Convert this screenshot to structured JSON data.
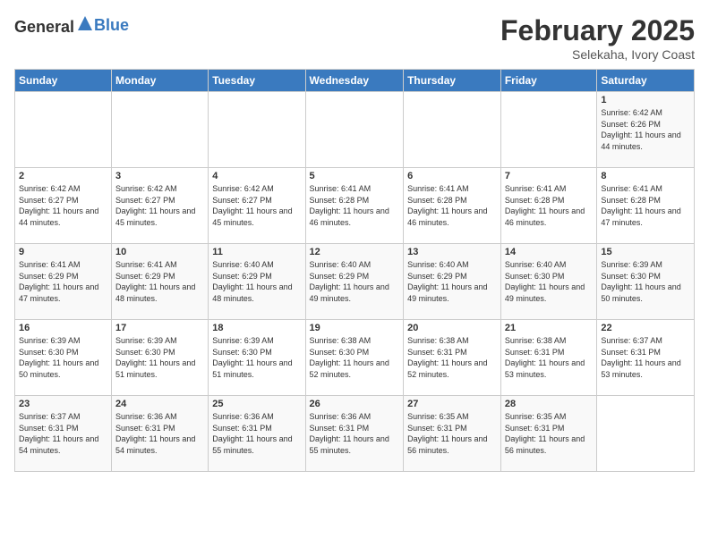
{
  "header": {
    "logo_general": "General",
    "logo_blue": "Blue",
    "month": "February 2025",
    "location": "Selekaha, Ivory Coast"
  },
  "days_of_week": [
    "Sunday",
    "Monday",
    "Tuesday",
    "Wednesday",
    "Thursday",
    "Friday",
    "Saturday"
  ],
  "weeks": [
    [
      {
        "day": "",
        "info": ""
      },
      {
        "day": "",
        "info": ""
      },
      {
        "day": "",
        "info": ""
      },
      {
        "day": "",
        "info": ""
      },
      {
        "day": "",
        "info": ""
      },
      {
        "day": "",
        "info": ""
      },
      {
        "day": "1",
        "info": "Sunrise: 6:42 AM\nSunset: 6:26 PM\nDaylight: 11 hours and 44 minutes."
      }
    ],
    [
      {
        "day": "2",
        "info": "Sunrise: 6:42 AM\nSunset: 6:27 PM\nDaylight: 11 hours and 44 minutes."
      },
      {
        "day": "3",
        "info": "Sunrise: 6:42 AM\nSunset: 6:27 PM\nDaylight: 11 hours and 45 minutes."
      },
      {
        "day": "4",
        "info": "Sunrise: 6:42 AM\nSunset: 6:27 PM\nDaylight: 11 hours and 45 minutes."
      },
      {
        "day": "5",
        "info": "Sunrise: 6:41 AM\nSunset: 6:28 PM\nDaylight: 11 hours and 46 minutes."
      },
      {
        "day": "6",
        "info": "Sunrise: 6:41 AM\nSunset: 6:28 PM\nDaylight: 11 hours and 46 minutes."
      },
      {
        "day": "7",
        "info": "Sunrise: 6:41 AM\nSunset: 6:28 PM\nDaylight: 11 hours and 46 minutes."
      },
      {
        "day": "8",
        "info": "Sunrise: 6:41 AM\nSunset: 6:28 PM\nDaylight: 11 hours and 47 minutes."
      }
    ],
    [
      {
        "day": "9",
        "info": "Sunrise: 6:41 AM\nSunset: 6:29 PM\nDaylight: 11 hours and 47 minutes."
      },
      {
        "day": "10",
        "info": "Sunrise: 6:41 AM\nSunset: 6:29 PM\nDaylight: 11 hours and 48 minutes."
      },
      {
        "day": "11",
        "info": "Sunrise: 6:40 AM\nSunset: 6:29 PM\nDaylight: 11 hours and 48 minutes."
      },
      {
        "day": "12",
        "info": "Sunrise: 6:40 AM\nSunset: 6:29 PM\nDaylight: 11 hours and 49 minutes."
      },
      {
        "day": "13",
        "info": "Sunrise: 6:40 AM\nSunset: 6:29 PM\nDaylight: 11 hours and 49 minutes."
      },
      {
        "day": "14",
        "info": "Sunrise: 6:40 AM\nSunset: 6:30 PM\nDaylight: 11 hours and 49 minutes."
      },
      {
        "day": "15",
        "info": "Sunrise: 6:39 AM\nSunset: 6:30 PM\nDaylight: 11 hours and 50 minutes."
      }
    ],
    [
      {
        "day": "16",
        "info": "Sunrise: 6:39 AM\nSunset: 6:30 PM\nDaylight: 11 hours and 50 minutes."
      },
      {
        "day": "17",
        "info": "Sunrise: 6:39 AM\nSunset: 6:30 PM\nDaylight: 11 hours and 51 minutes."
      },
      {
        "day": "18",
        "info": "Sunrise: 6:39 AM\nSunset: 6:30 PM\nDaylight: 11 hours and 51 minutes."
      },
      {
        "day": "19",
        "info": "Sunrise: 6:38 AM\nSunset: 6:30 PM\nDaylight: 11 hours and 52 minutes."
      },
      {
        "day": "20",
        "info": "Sunrise: 6:38 AM\nSunset: 6:31 PM\nDaylight: 11 hours and 52 minutes."
      },
      {
        "day": "21",
        "info": "Sunrise: 6:38 AM\nSunset: 6:31 PM\nDaylight: 11 hours and 53 minutes."
      },
      {
        "day": "22",
        "info": "Sunrise: 6:37 AM\nSunset: 6:31 PM\nDaylight: 11 hours and 53 minutes."
      }
    ],
    [
      {
        "day": "23",
        "info": "Sunrise: 6:37 AM\nSunset: 6:31 PM\nDaylight: 11 hours and 54 minutes."
      },
      {
        "day": "24",
        "info": "Sunrise: 6:36 AM\nSunset: 6:31 PM\nDaylight: 11 hours and 54 minutes."
      },
      {
        "day": "25",
        "info": "Sunrise: 6:36 AM\nSunset: 6:31 PM\nDaylight: 11 hours and 55 minutes."
      },
      {
        "day": "26",
        "info": "Sunrise: 6:36 AM\nSunset: 6:31 PM\nDaylight: 11 hours and 55 minutes."
      },
      {
        "day": "27",
        "info": "Sunrise: 6:35 AM\nSunset: 6:31 PM\nDaylight: 11 hours and 56 minutes."
      },
      {
        "day": "28",
        "info": "Sunrise: 6:35 AM\nSunset: 6:31 PM\nDaylight: 11 hours and 56 minutes."
      },
      {
        "day": "",
        "info": ""
      }
    ]
  ]
}
